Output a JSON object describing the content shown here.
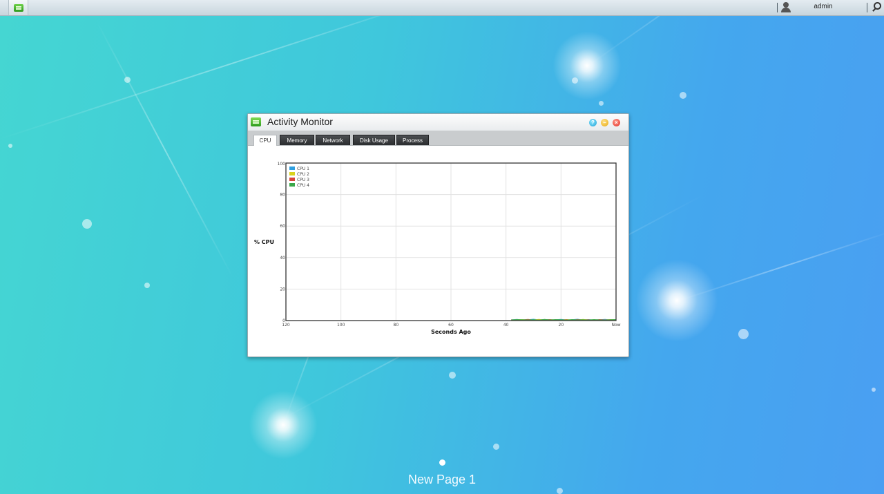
{
  "desktop": {
    "page_label": "New Page 1"
  },
  "taskbar": {
    "main_menu_icon": "activity-monitor-icon",
    "user_icon": "user-icon",
    "username": "admin",
    "search_icon": "search-icon"
  },
  "window": {
    "title": "Activity Monitor",
    "icon": "activity-monitor-icon",
    "buttons": [
      "help",
      "minimize",
      "close"
    ],
    "tabs": [
      {
        "label": "CPU",
        "active": true
      },
      {
        "label": "Memory",
        "active": false
      },
      {
        "label": "Network",
        "active": false
      },
      {
        "label": "Disk Usage",
        "active": false
      },
      {
        "label": "Process",
        "active": false
      }
    ]
  },
  "chart_data": {
    "type": "area",
    "title": "",
    "xlabel": "Seconds Ago",
    "ylabel": "% CPU",
    "xlim": [
      120,
      0
    ],
    "ylim": [
      0,
      100
    ],
    "x_ticks": [
      "120",
      "100",
      "80",
      "60",
      "40",
      "20",
      "Now"
    ],
    "y_ticks": [
      "100",
      "80",
      "60",
      "40",
      "20",
      "0"
    ],
    "grid": true,
    "legend_position": "top-left",
    "x": [
      38,
      36,
      34,
      32,
      30,
      28,
      26,
      24,
      22,
      20,
      18,
      16,
      14,
      12,
      10,
      8,
      6,
      4,
      2,
      0
    ],
    "series": [
      {
        "name": "CPU 1",
        "color": "#2f9fe0",
        "values": [
          0.5,
          0.8,
          0.4,
          0.6,
          0.9,
          0.5,
          0.7,
          0.4,
          0.6,
          0.8,
          0.5,
          0.6,
          0.9,
          0.4,
          0.7,
          0.5,
          0.6,
          0.8,
          0.5,
          0.6
        ]
      },
      {
        "name": "CPU 2",
        "color": "#d9d21c",
        "values": [
          0.4,
          0.6,
          0.7,
          0.3,
          0.5,
          0.8,
          0.4,
          0.6,
          0.5,
          0.4,
          0.7,
          0.5,
          0.4,
          0.8,
          0.5,
          0.6,
          0.4,
          0.5,
          0.7,
          0.5
        ]
      },
      {
        "name": "CPU 3",
        "color": "#d9453a",
        "values": [
          0.6,
          0.4,
          0.5,
          0.8,
          0.4,
          0.5,
          0.6,
          0.7,
          0.4,
          0.5,
          0.6,
          0.4,
          0.7,
          0.5,
          0.6,
          0.4,
          0.7,
          0.5,
          0.6,
          0.4
        ]
      },
      {
        "name": "CPU 4",
        "color": "#3aa84a",
        "values": [
          0.5,
          0.7,
          0.6,
          0.5,
          0.6,
          0.4,
          0.8,
          0.5,
          0.7,
          0.6,
          0.4,
          0.7,
          0.5,
          0.6,
          0.4,
          0.7,
          0.5,
          0.4,
          0.6,
          0.7
        ]
      }
    ]
  }
}
